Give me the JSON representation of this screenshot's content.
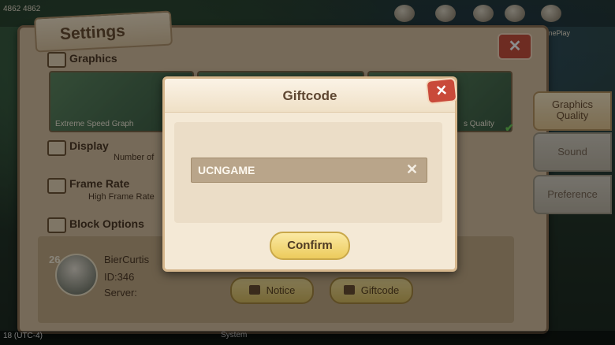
{
  "hud": {
    "coords": "4862 4862",
    "gameplay_label": "GamePlay"
  },
  "settings": {
    "title": "Settings",
    "close_symbol": "✕",
    "sections": {
      "graphics": "Graphics",
      "display": "Display",
      "display_sub": "Number of",
      "frame_rate": "Frame Rate",
      "frame_rate_sub": "High Frame Rate",
      "block_options": "Block Options"
    },
    "graphics_cards": [
      {
        "label": "Extreme Speed Graph"
      },
      {
        "label": ""
      },
      {
        "label": "s Quality"
      }
    ],
    "side_tabs": [
      {
        "label": "Graphics Quality",
        "active": true
      },
      {
        "label": "Sound",
        "active": false
      },
      {
        "label": "Preference",
        "active": false
      }
    ],
    "profile": {
      "level": "26",
      "name": "BierCurtis",
      "id": "ID:346",
      "server": "Server:"
    },
    "buttons": {
      "notice": "Notice",
      "giftcode": "Giftcode"
    }
  },
  "bottom_bar": {
    "left_text": "18 (UTC-4)",
    "chat_text": "System"
  },
  "gift_dialog": {
    "title": "Giftcode",
    "close_symbol": "✕",
    "input_value": "UCNGAME",
    "clear_symbol": "✕",
    "confirm_label": "Confirm"
  }
}
